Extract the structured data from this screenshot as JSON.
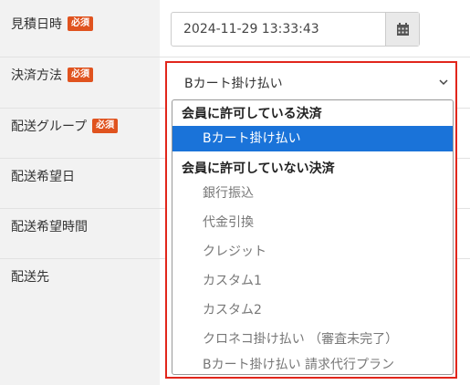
{
  "form": {
    "required_badge": "必須",
    "rows": [
      {
        "label": "見積日時",
        "required": true
      },
      {
        "label": "決済方法",
        "required": true
      },
      {
        "label": "配送グループ",
        "required": true
      },
      {
        "label": "配送希望日",
        "required": false
      },
      {
        "label": "配送希望時間",
        "required": false
      },
      {
        "label": "配送先",
        "required": false
      }
    ],
    "quote_datetime": "2024-11-29 13:33:43",
    "payment_selected": "Bカート掛け払い"
  },
  "dropdown": {
    "groups": [
      {
        "label": "会員に許可している決済",
        "options": [
          {
            "label": "Bカート掛け払い",
            "selected": true
          }
        ]
      },
      {
        "label": "会員に許可していない決済",
        "options": [
          {
            "label": "銀行振込",
            "selected": false
          },
          {
            "label": "代金引換",
            "selected": false
          },
          {
            "label": "クレジット",
            "selected": false
          },
          {
            "label": "カスタム1",
            "selected": false
          },
          {
            "label": "カスタム2",
            "selected": false
          },
          {
            "label": "クロネコ掛け払い （審査未完了）",
            "selected": false
          },
          {
            "label": "Bカート掛け払い 請求代行プラン",
            "selected": false
          }
        ]
      }
    ]
  },
  "colors": {
    "required_badge": "#e0531f",
    "highlight_frame": "#e1261c",
    "selected_option": "#1a73d9"
  },
  "icons": {
    "calendar": "calendar-icon",
    "select_arrow": "chevron-down-icon"
  }
}
